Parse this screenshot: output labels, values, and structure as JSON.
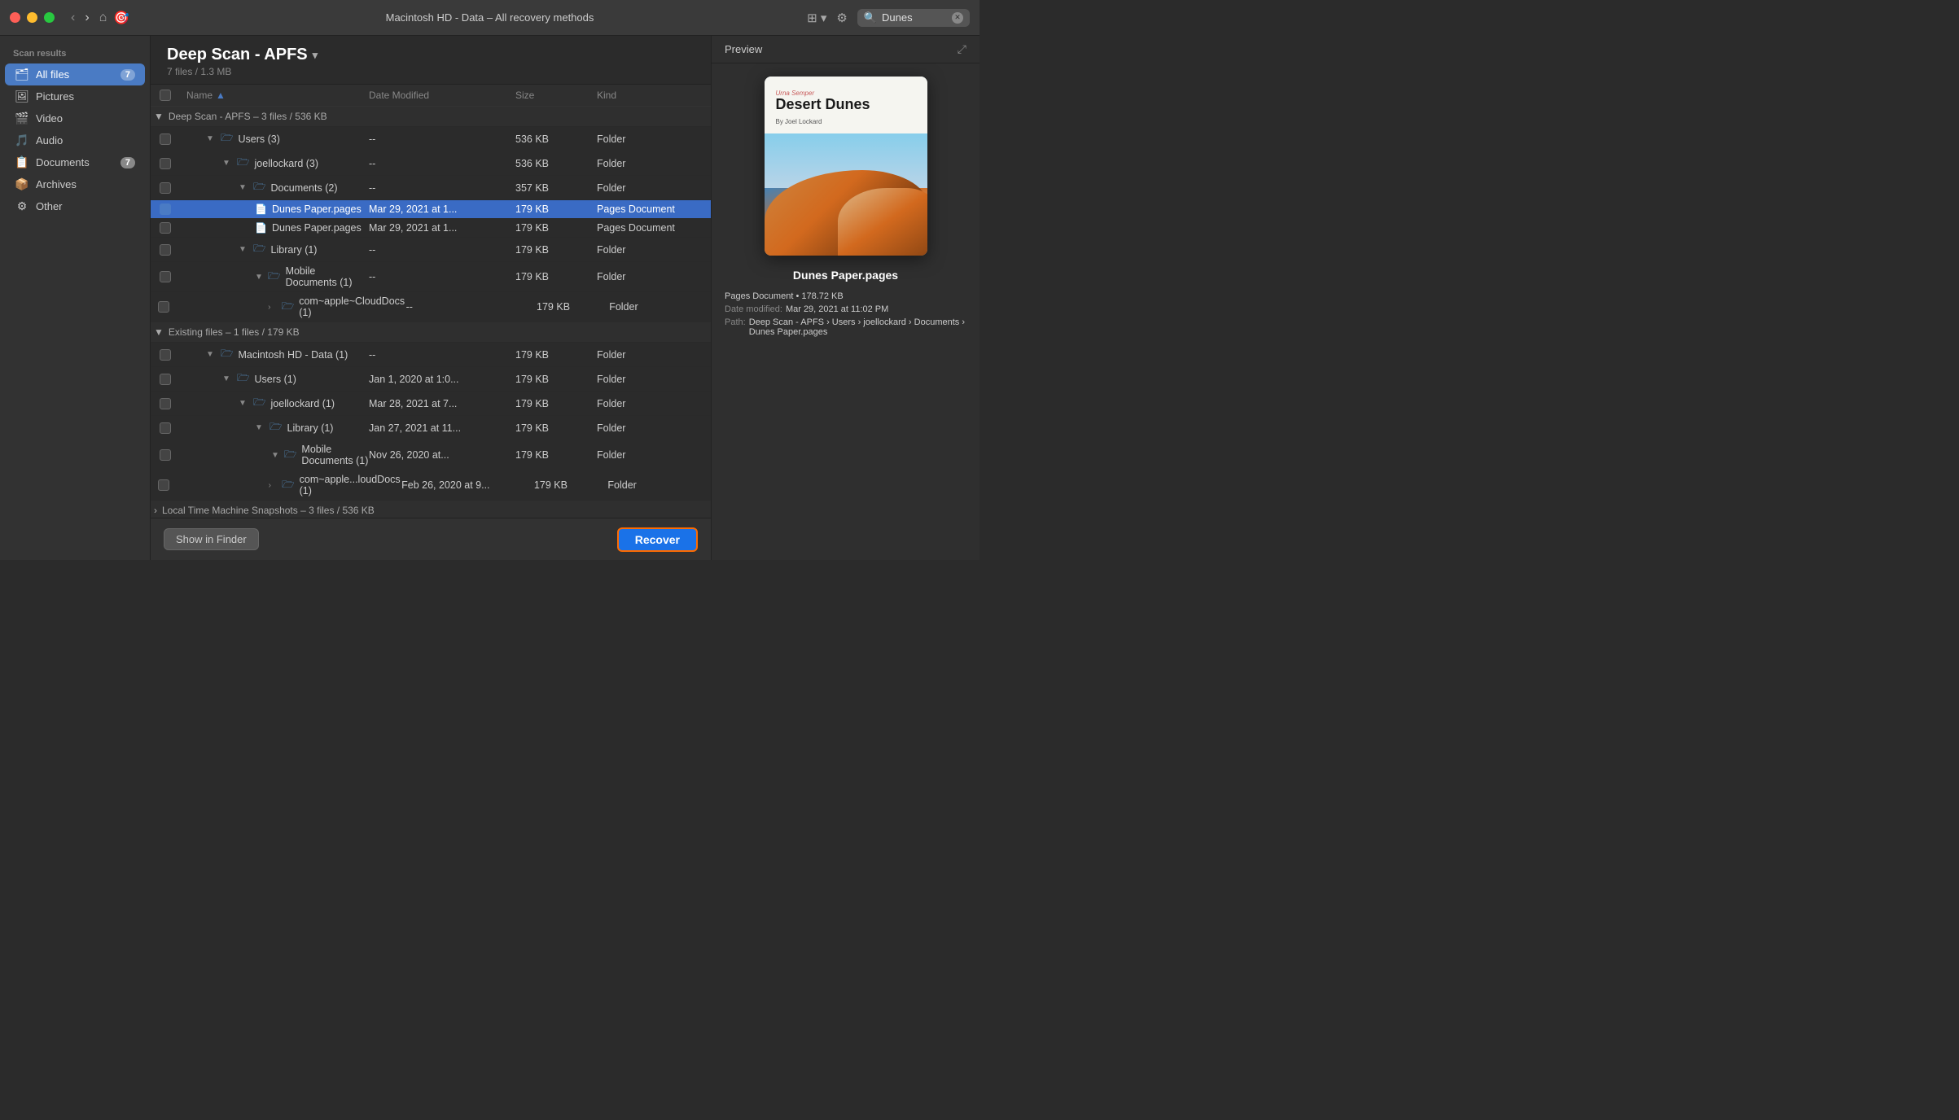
{
  "titlebar": {
    "title": "Macintosh HD - Data – All recovery methods",
    "search_placeholder": "Dunes"
  },
  "sidebar": {
    "section_label": "Scan results",
    "items": [
      {
        "id": "all-files",
        "label": "All files",
        "icon": "🗂",
        "badge": "7",
        "active": true
      },
      {
        "id": "pictures",
        "label": "Pictures",
        "icon": "🖼",
        "badge": "",
        "active": false
      },
      {
        "id": "video",
        "label": "Video",
        "icon": "🎬",
        "badge": "",
        "active": false
      },
      {
        "id": "audio",
        "label": "Audio",
        "icon": "🎵",
        "badge": "",
        "active": false
      },
      {
        "id": "documents",
        "label": "Documents",
        "icon": "📋",
        "badge": "7",
        "active": false
      },
      {
        "id": "archives",
        "label": "Archives",
        "icon": "📦",
        "badge": "",
        "active": false
      },
      {
        "id": "other",
        "label": "Other",
        "icon": "⚙",
        "badge": "",
        "active": false
      }
    ]
  },
  "content": {
    "scan_title": "Deep Scan - APFS",
    "scan_subtitle": "7 files / 1.3 MB",
    "columns": {
      "name": "Name",
      "date_modified": "Date Modified",
      "size": "Size",
      "kind": "Kind"
    },
    "sections": [
      {
        "id": "deep-scan-apfs",
        "label": "Deep Scan - APFS",
        "meta": "3 files / 536 KB",
        "expanded": true,
        "children": [
          {
            "id": "users-3",
            "type": "folder",
            "name": "Users (3)",
            "indent": 1,
            "date": "--",
            "size": "536 KB",
            "kind": "Folder",
            "expanded": true,
            "children": [
              {
                "id": "joellockard-3",
                "type": "folder",
                "name": "joellockard (3)",
                "indent": 2,
                "date": "--",
                "size": "536 KB",
                "kind": "Folder",
                "expanded": true,
                "children": [
                  {
                    "id": "documents-2",
                    "type": "folder",
                    "name": "Documents (2)",
                    "indent": 3,
                    "date": "--",
                    "size": "357 KB",
                    "kind": "Folder",
                    "expanded": true,
                    "children": [
                      {
                        "id": "dunes-paper-1",
                        "type": "file",
                        "name": "Dunes Paper.pages",
                        "indent": 4,
                        "date": "Mar 29, 2021 at 1...",
                        "size": "179 KB",
                        "kind": "Pages Document",
                        "selected": true
                      },
                      {
                        "id": "dunes-paper-2",
                        "type": "file",
                        "name": "Dunes Paper.pages",
                        "indent": 4,
                        "date": "Mar 29, 2021 at 1...",
                        "size": "179 KB",
                        "kind": "Pages Document",
                        "selected": false
                      }
                    ]
                  },
                  {
                    "id": "library-1",
                    "type": "folder",
                    "name": "Library (1)",
                    "indent": 3,
                    "date": "--",
                    "size": "179 KB",
                    "kind": "Folder",
                    "expanded": true,
                    "children": [
                      {
                        "id": "mobile-docs-1",
                        "type": "folder",
                        "name": "Mobile Documents (1)",
                        "indent": 4,
                        "date": "--",
                        "size": "179 KB",
                        "kind": "Folder",
                        "expanded": true,
                        "children": [
                          {
                            "id": "cloud-docs-1",
                            "type": "folder",
                            "name": "com~apple~CloudDocs (1)",
                            "indent": 5,
                            "date": "--",
                            "size": "179 KB",
                            "kind": "Folder"
                          }
                        ]
                      }
                    ]
                  }
                ]
              }
            ]
          }
        ]
      },
      {
        "id": "existing-files",
        "label": "Existing files",
        "meta": "1 files / 179 KB",
        "expanded": true,
        "children": [
          {
            "id": "macos-data-1",
            "type": "folder",
            "name": "Macintosh HD - Data (1)",
            "indent": 1,
            "date": "--",
            "size": "179 KB",
            "kind": "Folder",
            "expanded": true,
            "children": [
              {
                "id": "users-1",
                "type": "folder",
                "name": "Users (1)",
                "indent": 2,
                "date": "Jan 1, 2020 at 1:0...",
                "size": "179 KB",
                "kind": "Folder",
                "expanded": true,
                "children": [
                  {
                    "id": "joellockard-1",
                    "type": "folder",
                    "name": "joellockard (1)",
                    "indent": 3,
                    "date": "Mar 28, 2021 at 7...",
                    "size": "179 KB",
                    "kind": "Folder",
                    "expanded": true,
                    "children": [
                      {
                        "id": "library-2",
                        "type": "folder",
                        "name": "Library (1)",
                        "indent": 4,
                        "date": "Jan 27, 2021 at 11...",
                        "size": "179 KB",
                        "kind": "Folder",
                        "expanded": true,
                        "children": [
                          {
                            "id": "mobile-docs-2",
                            "type": "folder",
                            "name": "Mobile Documents (1)",
                            "indent": 5,
                            "date": "Nov 26, 2020 at...",
                            "size": "179 KB",
                            "kind": "Folder",
                            "expanded": true,
                            "children": [
                              {
                                "id": "cloud-docs-2",
                                "type": "folder",
                                "name": "com~apple...loudDocs (1)",
                                "indent": 5,
                                "date": "Feb 26, 2020 at 9...",
                                "size": "179 KB",
                                "kind": "Folder"
                              }
                            ]
                          }
                        ]
                      }
                    ]
                  }
                ]
              }
            ]
          }
        ]
      },
      {
        "id": "local-time-machine",
        "label": "Local Time Machine Snapshots",
        "meta": "3 files / 536 KB",
        "expanded": false,
        "children": []
      }
    ]
  },
  "preview": {
    "title": "Preview",
    "file_name": "Dunes Paper.pages",
    "file_type": "Pages Document",
    "file_size": "178.72 KB",
    "date_modified_label": "Date modified:",
    "date_modified_value": "Mar 29, 2021 at 11:02 PM",
    "path_label": "Path:",
    "path_value": "Deep Scan - APFS › Users › joellockard › Documents › Dunes Paper.pages",
    "cover": {
      "subtitle": "Urna Semper",
      "title": "Desert Dunes",
      "author": "By Joel Lockard"
    }
  },
  "bottom": {
    "show_in_finder": "Show in Finder",
    "recover": "Recover"
  }
}
